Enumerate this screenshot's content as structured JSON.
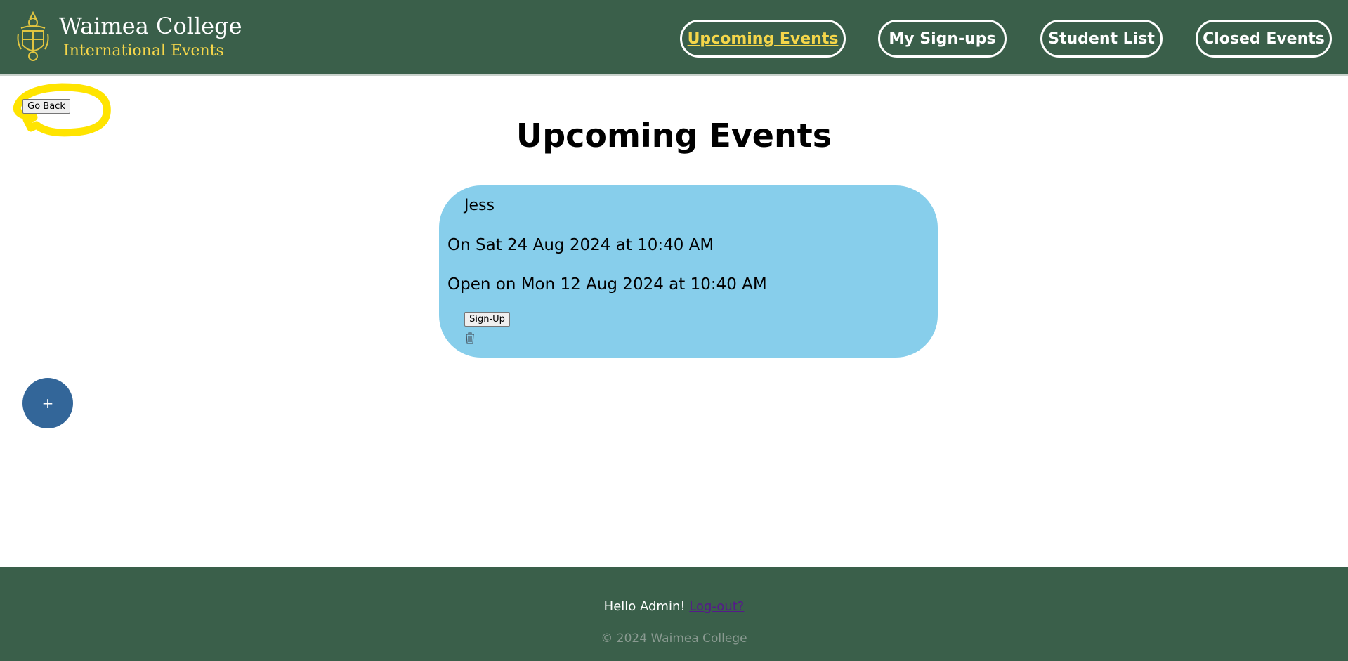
{
  "header": {
    "brand_title": "Waimea College",
    "brand_subtitle": "International Events",
    "nav": [
      {
        "label": "Upcoming Events",
        "active": true
      },
      {
        "label": "My Sign-ups",
        "active": false
      },
      {
        "label": "Student List",
        "active": false
      },
      {
        "label": "Closed Events",
        "active": false
      }
    ]
  },
  "go_back_label": "Go Back",
  "page_title": "Upcoming Events",
  "events": [
    {
      "name": "Jess",
      "date_text": "On Sat 24 Aug 2024 at 10:40 AM",
      "open_text": "Open on Mon 12 Aug 2024 at 10:40 AM",
      "signup_label": "Sign-Up",
      "delete_icon": "trash-icon"
    }
  ],
  "fab_label": "+",
  "footer": {
    "greeting": "Hello Admin!",
    "logout_label": "Log-out?",
    "copyright": "© 2024 Waimea College"
  },
  "colors": {
    "header_bg": "#3a5f4a",
    "accent_yellow": "#f5d64a",
    "card_bg": "#87ceeb",
    "fab_bg": "#336699",
    "highlight": "#ffe400"
  }
}
